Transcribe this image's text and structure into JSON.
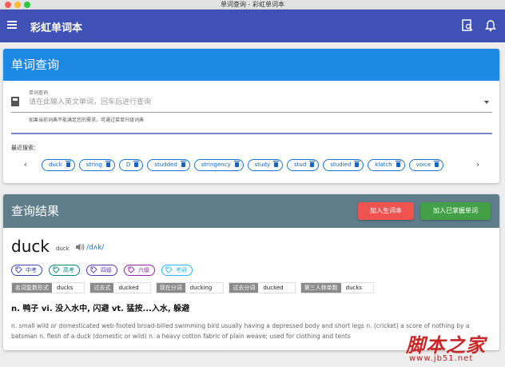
{
  "window": {
    "title": "单词查询 - 彩虹单词本"
  },
  "appbar": {
    "title": "彩虹单词本"
  },
  "query_card": {
    "title": "单词查询",
    "input_label": "单词查询",
    "input_placeholder": "请在此输入英文单词，回车后进行查询",
    "hint": "如果当前词典不能满足您的需求，可通过菜单升级词典",
    "recent_label": "最近搜索：",
    "recent": [
      "duck",
      "string",
      "D",
      "studded",
      "stringency",
      "study",
      "stud",
      "studied",
      "klatch",
      "voice"
    ]
  },
  "result_card": {
    "title": "查询结果",
    "btn_add_new": "加入生词本",
    "btn_add_mastered": "加入已掌握单词",
    "word": "duck",
    "word_small": "duck",
    "phonetic": "/dʌk/",
    "tags": [
      {
        "label": "中考",
        "color": "#3949ab"
      },
      {
        "label": "高考",
        "color": "#00897b"
      },
      {
        "label": "四级",
        "color": "#5e35b1"
      },
      {
        "label": "六级",
        "color": "#8e24aa"
      },
      {
        "label": "考研",
        "color": "#29b6f6"
      }
    ],
    "forms": [
      {
        "label": "名词复数形式",
        "value": "ducks"
      },
      {
        "label": "过去式",
        "value": "ducked"
      },
      {
        "label": "现在分词",
        "value": "ducking"
      },
      {
        "label": "过去分词",
        "value": "ducked"
      },
      {
        "label": "第三人称单数",
        "value": "ducks"
      }
    ],
    "cn_definition": "n. 鸭子 vi. 没入水中, 闪避 vt. 猛按...入水, 躲避",
    "en_definition": "n. small wild or domesticated web-footed broad-billed swimming bird usually having a depressed body and short legs n. (cricket) a score of nothing by a batsman n. flesh of a duck (domestic or wild) n. a heavy cotton fabric of plain weave; used for clothing and tents"
  },
  "watermark": {
    "text": "脚本之家",
    "url": "www.jb51.net"
  }
}
